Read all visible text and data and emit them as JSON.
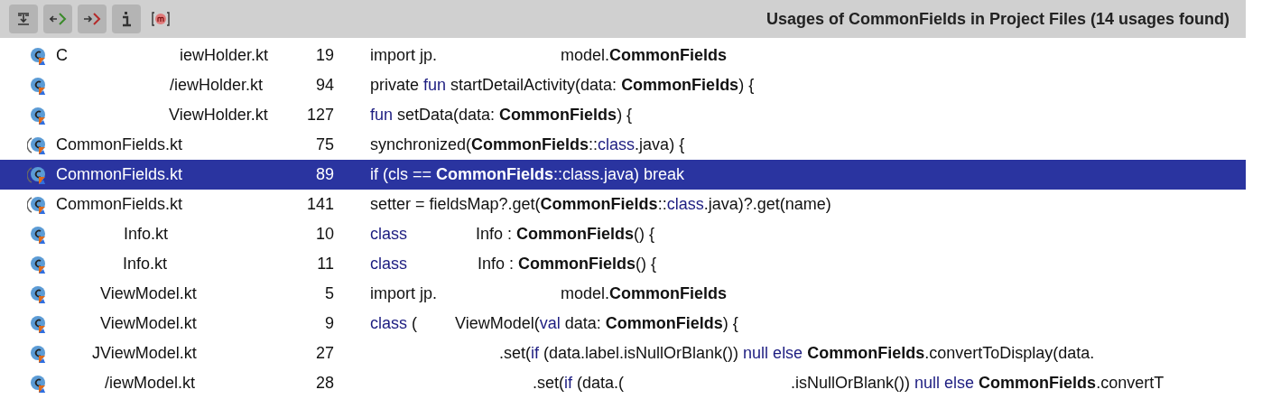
{
  "toolbar": {
    "buttons": [
      {
        "kind": "expand",
        "pressed": true
      },
      {
        "kind": "import",
        "pressed": true
      },
      {
        "kind": "export",
        "pressed": true
      },
      {
        "kind": "info",
        "pressed": true
      },
      {
        "kind": "method",
        "pressed": false
      }
    ]
  },
  "title": "Usages of CommonFields in Project Files (14 usages found)",
  "rows": [
    {
      "icon_outlined": false,
      "selected": false,
      "prefix": "C",
      "file": "iewHolder.kt",
      "line": "19",
      "code": [
        [
          {
            "text": "import jp.",
            "kind": "plain"
          }
        ],
        [
          {
            "text": "model.",
            "kind": "plain"
          },
          {
            "text": "CommonFields",
            "kind": "bold"
          }
        ]
      ]
    },
    {
      "icon_outlined": false,
      "selected": false,
      "file": "/iewHolder.kt",
      "line": "94",
      "code": [
        [
          {
            "text": "private ",
            "kind": "plain"
          },
          {
            "text": "fun",
            "kind": "keyword"
          },
          {
            "text": " startDetailActivity(data: ",
            "kind": "plain"
          },
          {
            "text": "CommonFields",
            "kind": "bold"
          },
          {
            "text": ") {",
            "kind": "plain"
          }
        ]
      ]
    },
    {
      "icon_outlined": false,
      "selected": false,
      "file": "ViewHolder.kt",
      "line": "127",
      "code": [
        [
          {
            "text": "fun",
            "kind": "keyword"
          },
          {
            "text": " setData(data: ",
            "kind": "plain"
          },
          {
            "text": "CommonFields",
            "kind": "bold"
          },
          {
            "text": ") {",
            "kind": "plain"
          }
        ]
      ]
    },
    {
      "icon_outlined": true,
      "selected": false,
      "file": "CommonFields.kt",
      "line": "75",
      "code": [
        [
          {
            "text": "synchronized(",
            "kind": "plain"
          },
          {
            "text": "CommonFields",
            "kind": "bold"
          },
          {
            "text": "::",
            "kind": "plain"
          },
          {
            "text": "class",
            "kind": "keyword"
          },
          {
            "text": ".java) {",
            "kind": "plain"
          }
        ]
      ]
    },
    {
      "icon_outlined": true,
      "selected": true,
      "file": "CommonFields.kt",
      "line": "89",
      "code": [
        [
          {
            "text": "if (cls == ",
            "kind": "plain"
          },
          {
            "text": "CommonFields",
            "kind": "bold"
          },
          {
            "text": "::",
            "kind": "plain"
          },
          {
            "text": "class",
            "kind": "keyword"
          },
          {
            "text": ".java) break",
            "kind": "plain"
          }
        ]
      ]
    },
    {
      "icon_outlined": true,
      "selected": false,
      "file": "CommonFields.kt",
      "line": "141",
      "code": [
        [
          {
            "text": "setter = fieldsMap?.get(",
            "kind": "plain"
          },
          {
            "text": "CommonFields",
            "kind": "bold"
          },
          {
            "text": "::",
            "kind": "plain"
          },
          {
            "text": "class",
            "kind": "keyword"
          },
          {
            "text": ".java)?.get(name)",
            "kind": "plain"
          }
        ]
      ]
    },
    {
      "icon_outlined": false,
      "selected": false,
      "file": "Info.kt",
      "line": "10",
      "code": [
        [
          {
            "text": "class",
            "kind": "keyword"
          }
        ],
        [
          {
            "text": "Info : ",
            "kind": "plain"
          },
          {
            "text": "CommonFields",
            "kind": "bold"
          },
          {
            "text": "() {",
            "kind": "plain"
          }
        ]
      ]
    },
    {
      "icon_outlined": false,
      "selected": false,
      "file": "Info.kt",
      "line": "11",
      "code": [
        [
          {
            "text": "class",
            "kind": "keyword"
          }
        ],
        [
          {
            "text": "Info : ",
            "kind": "plain"
          },
          {
            "text": "CommonFields",
            "kind": "bold"
          },
          {
            "text": "() {",
            "kind": "plain"
          }
        ]
      ]
    },
    {
      "icon_outlined": false,
      "selected": false,
      "file": "ViewModel.kt",
      "line": "5",
      "code": [
        [
          {
            "text": "import jp.",
            "kind": "plain"
          }
        ],
        [
          {
            "text": "model.",
            "kind": "plain"
          },
          {
            "text": "CommonFields",
            "kind": "bold"
          }
        ]
      ]
    },
    {
      "icon_outlined": false,
      "selected": false,
      "file": "ViewModel.kt",
      "line": "9",
      "code": [
        [
          {
            "text": "class",
            "kind": "keyword"
          },
          {
            "text": " (",
            "kind": "plain"
          }
        ],
        [
          {
            "text": "ViewModel(",
            "kind": "plain"
          },
          {
            "text": "val",
            "kind": "keyword"
          },
          {
            "text": " data: ",
            "kind": "plain"
          },
          {
            "text": "CommonFields",
            "kind": "bold"
          },
          {
            "text": ") {",
            "kind": "plain"
          }
        ]
      ]
    },
    {
      "icon_outlined": false,
      "selected": false,
      "file": "JViewModel.kt",
      "line": "27",
      "code": [
        [
          {
            "text": ".set(",
            "kind": "plain"
          },
          {
            "text": "if",
            "kind": "keyword"
          },
          {
            "text": " (data.label.isNullOrBlank()) ",
            "kind": "plain"
          },
          {
            "text": "null else ",
            "kind": "keyword"
          },
          {
            "text": "CommonFields",
            "kind": "bold"
          },
          {
            "text": ".convertToDisplay(data.",
            "kind": "plain"
          }
        ]
      ]
    },
    {
      "icon_outlined": false,
      "selected": false,
      "file": "/iewModel.kt",
      "line": "28",
      "code": [
        [
          {
            "text": ".set(",
            "kind": "plain"
          },
          {
            "text": "if",
            "kind": "keyword"
          },
          {
            "text": " (data.(",
            "kind": "plain"
          }
        ],
        [
          {
            "text": ".isNullOrBlank()) ",
            "kind": "plain"
          },
          {
            "text": "null else ",
            "kind": "keyword"
          },
          {
            "text": "CommonFields",
            "kind": "bold"
          },
          {
            "text": ".convertT",
            "kind": "plain"
          }
        ]
      ]
    }
  ]
}
